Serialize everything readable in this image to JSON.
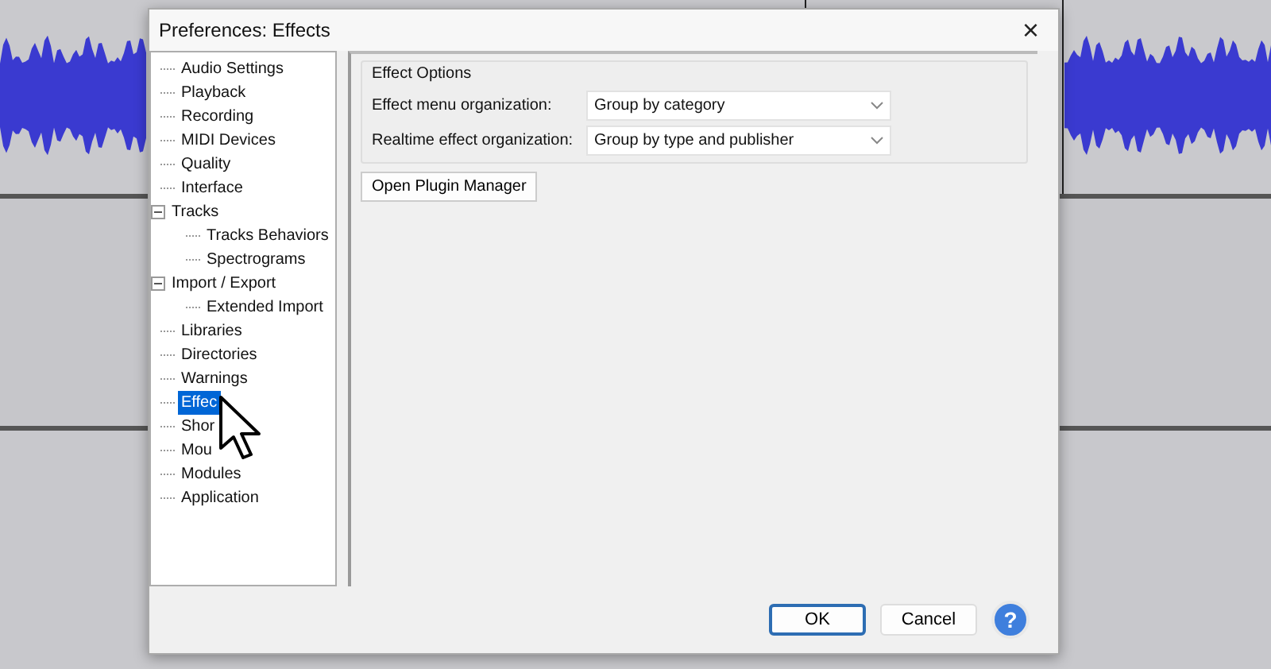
{
  "dialog": {
    "title": "Preferences: Effects",
    "close": "×"
  },
  "tree": [
    {
      "label": "Audio Settings",
      "selected": false
    },
    {
      "label": "Playback",
      "selected": false
    },
    {
      "label": "Recording",
      "selected": false
    },
    {
      "label": "MIDI Devices",
      "selected": false
    },
    {
      "label": "Quality",
      "selected": false
    },
    {
      "label": "Interface",
      "selected": false
    },
    {
      "label": "Tracks",
      "selected": false,
      "expanded": true,
      "children": [
        {
          "label": "Tracks Behaviors",
          "selected": false
        },
        {
          "label": "Spectrograms",
          "selected": false
        }
      ]
    },
    {
      "label": "Import / Export",
      "selected": false,
      "expanded": true,
      "children": [
        {
          "label": "Extended Import",
          "selected": false
        }
      ]
    },
    {
      "label": "Libraries",
      "selected": false
    },
    {
      "label": "Directories",
      "selected": false
    },
    {
      "label": "Warnings",
      "selected": false
    },
    {
      "label": "Effec",
      "selected": true
    },
    {
      "label": "Shor",
      "selected": false
    },
    {
      "label": "Mou",
      "selected": false
    },
    {
      "label": "Modules",
      "selected": false
    },
    {
      "label": "Application",
      "selected": false
    }
  ],
  "effect_options": {
    "title": "Effect Options",
    "fields": [
      {
        "label": "Effect menu organization:",
        "value": "Group by category"
      },
      {
        "label": "Realtime effect organization:",
        "value": "Group by type and publisher"
      }
    ]
  },
  "plugin_button": "Open Plugin Manager",
  "buttons": [
    {
      "label": "OK",
      "default": true
    },
    {
      "label": "Cancel",
      "default": false
    }
  ],
  "help": "?"
}
